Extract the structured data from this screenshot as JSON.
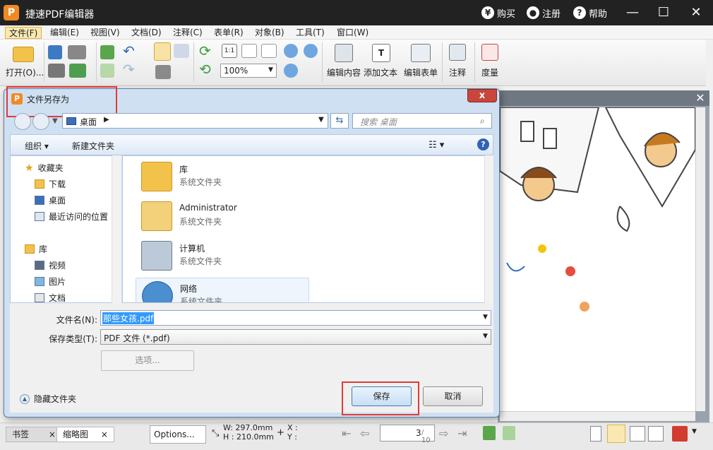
{
  "app": {
    "title": "捷速PDF编辑器",
    "logo_letter": "P",
    "buy_label": "购买",
    "register_label": "注册",
    "help_label": "帮助"
  },
  "menu": [
    "文件(F)",
    "编辑(E)",
    "视图(V)",
    "文档(D)",
    "注释(C)",
    "表单(R)",
    "对象(B)",
    "工具(T)",
    "窗口(W)"
  ],
  "toolbar": {
    "open_label": "打开(O)...",
    "zoom_value": "100%",
    "edit_content_label": "编辑内容",
    "add_text_label": "添加文本",
    "edit_form_label": "编辑表单",
    "annotate_label": "注释",
    "measure_label": "度量"
  },
  "dialog": {
    "title": "文件另存为",
    "close_label": "x",
    "path": "桌面",
    "search_placeholder": "搜索 桌面",
    "organize_label": "组织 ▾",
    "new_folder_label": "新建文件夹",
    "nav_items": [
      {
        "label": "收藏夹",
        "icon": "star-icon"
      },
      {
        "label": "下载",
        "icon": "download-folder-icon"
      },
      {
        "label": "桌面",
        "icon": "desktop-icon"
      },
      {
        "label": "最近访问的位置",
        "icon": "recent-places-icon"
      },
      {
        "label": "库",
        "icon": "library-icon"
      },
      {
        "label": "视频",
        "icon": "video-icon"
      },
      {
        "label": "图片",
        "icon": "picture-icon"
      },
      {
        "label": "文档",
        "icon": "document-icon"
      }
    ],
    "files": [
      {
        "name": "库",
        "type": "系统文件夹",
        "icon": "library-folder-icon"
      },
      {
        "name": "Administrator",
        "type": "系统文件夹",
        "icon": "user-folder-icon"
      },
      {
        "name": "计算机",
        "type": "系统文件夹",
        "icon": "computer-icon"
      },
      {
        "name": "网络",
        "type": "系统文件夹",
        "icon": "network-icon"
      }
    ],
    "filename_label": "文件名(N):",
    "filename_value": "那些女孩.pdf",
    "filetype_label": "保存类型(T):",
    "filetype_value": "PDF 文件 (*.pdf)",
    "options_label": "选项...",
    "hide_folders_label": "隐藏文件夹",
    "save_label": "保存",
    "cancel_label": "取消"
  },
  "status": {
    "bookmarks_tab": "书签",
    "thumbnails_tab": "缩略图",
    "options_label": "Options...",
    "width_label": "W: 297.0mm",
    "height_label": "H : 210.0mm",
    "x_label": "X :",
    "y_label": "Y :",
    "page_current": "3",
    "page_total": "/ 10"
  },
  "colors": {
    "accent_orange": "#f08a24",
    "highlight_red": "#e03a3a",
    "selection_blue": "#3399ff"
  }
}
